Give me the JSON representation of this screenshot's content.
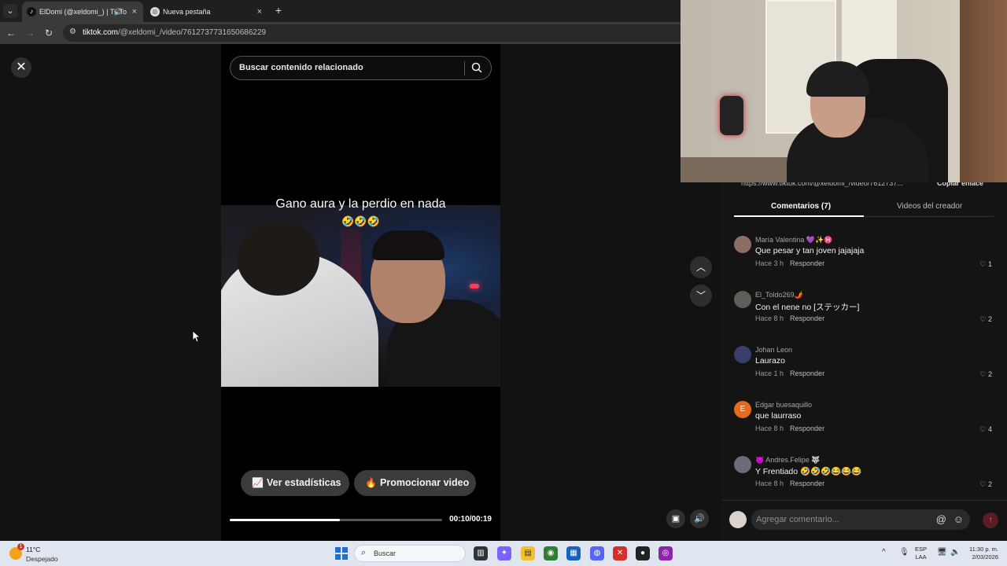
{
  "browser": {
    "tabs": [
      {
        "title": "ElDomi (@xeldomi_) | TikTo",
        "active": true
      },
      {
        "title": "Nueva pestaña",
        "active": false
      }
    ],
    "url_host": "tiktok.com",
    "url_path": "/@xeldomi_/video/7612737731650686229"
  },
  "video": {
    "search_placeholder": "Buscar contenido relacionado",
    "caption": "Gano aura y la perdio en nada",
    "caption_emoji": "🤣🤣🤣",
    "stats_button": "Ver estadísticas",
    "promote_button": "Promocionar video",
    "time": "00:10/00:19",
    "progress": 0.52
  },
  "panel": {
    "share_link_peek": "https://www.tiktok.com/@xeldomi_/video/7612737...",
    "copy_link": "Copiar enlace",
    "tab_comments": "Comentarios (7)",
    "tab_creator": "Videos del creador",
    "comments": [
      {
        "user": "María Valentina 💜✨♓",
        "text": "Que pesar y tan joven jajajaja",
        "time": "Hace 3 h",
        "reply": "Responder",
        "likes": "1",
        "avatar_color": "#8c6f62",
        "initial": ""
      },
      {
        "user": "El_Toldo269🌶️",
        "text": "Con el nene no [ステッカー]",
        "time": "Hace 8 h",
        "reply": "Responder",
        "likes": "2",
        "avatar_color": "#5d5f57",
        "initial": ""
      },
      {
        "user": "Johan Leon",
        "text": "Laurazo",
        "time": "Hace 1 h",
        "reply": "Responder",
        "likes": "2",
        "avatar_color": "#3a3f6b",
        "initial": ""
      },
      {
        "user": "Edgar buesaquillo",
        "text": "que laurraso",
        "time": "Hace 8 h",
        "reply": "Responder",
        "likes": "4",
        "avatar_color": "#e46b1d",
        "initial": "E"
      },
      {
        "user": "👿 Andres.Felipe 🐺",
        "text": "Y Frentiado 🤣🤣🤣😂😂😂",
        "time": "Hace 8 h",
        "reply": "Responder",
        "likes": "2",
        "avatar_color": "#6a6c78",
        "initial": ""
      }
    ],
    "comment_placeholder": "Agregar comentario..."
  },
  "taskbar": {
    "temp": "11°C",
    "condition": "Despejado",
    "weather_badge": "1",
    "search_placeholder": "Buscar",
    "lang_top": "ESP",
    "lang_bottom": "LAA",
    "time": "11:30 p. m.",
    "date": "2/03/2026"
  },
  "icons": [
    "close-icon",
    "search-icon",
    "chevron-up-icon",
    "chevron-down-icon",
    "volume-icon",
    "heart-icon",
    "at-icon",
    "emoji-icon",
    "send-icon",
    "chart-icon",
    "flame-icon",
    "windows-start-icon"
  ]
}
